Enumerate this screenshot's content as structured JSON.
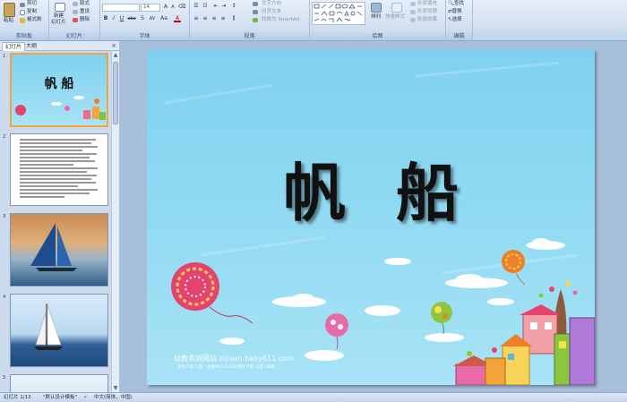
{
  "ribbon": {
    "clipboard": {
      "label": "剪贴板",
      "paste": "粘贴",
      "cut": "剪切",
      "copy": "复制",
      "format_painter": "格式刷"
    },
    "slides": {
      "label": "幻灯片",
      "new_slide": "新建",
      "new_slide2": "幻灯片",
      "layout": "版式",
      "reset": "重设",
      "delete": "删除"
    },
    "font": {
      "label": "字体",
      "font_name": "",
      "font_size": "14",
      "bold": "B",
      "italic": "I",
      "underline": "U",
      "strike": "abe",
      "shadow": "S",
      "spacing": "AV",
      "case": "Aa",
      "color": "A"
    },
    "paragraph": {
      "label": "段落",
      "text_direction": "文字方向",
      "align_text": "对齐文本",
      "smartart": "转换为 SmartArt"
    },
    "drawing": {
      "label": "绘图",
      "arrange": "排列",
      "quick_styles": "快速样式",
      "shape_fill": "形状填充",
      "shape_outline": "形状轮廓",
      "shape_effects": "形状效果"
    },
    "editing": {
      "label": "编辑",
      "find": "查找",
      "replace": "替换",
      "select": "选择"
    }
  },
  "left_pane": {
    "tab_slides": "幻灯片",
    "tab_outline": "大纲",
    "close": "×",
    "thumb1_title": "帆  船",
    "slide_numbers": [
      "1",
      "2",
      "3",
      "4",
      "5"
    ]
  },
  "slide": {
    "title": "帆船",
    "watermark_main": "幼教资源网站  ziyuan.baby611.com",
    "watermark_sub": "课件下载  儿歌、故事MP3  FLASH课件下载  试卷下载库"
  },
  "status": {
    "slide_info": "幻灯片 1/13",
    "theme": "\"默认设计模板\"",
    "language": "中文(简体，中国)"
  },
  "colors": {
    "accent_selected": "#f2a33a",
    "slide_sky": "#8fd9f2",
    "ribbon_bg": "#cfdff1"
  }
}
